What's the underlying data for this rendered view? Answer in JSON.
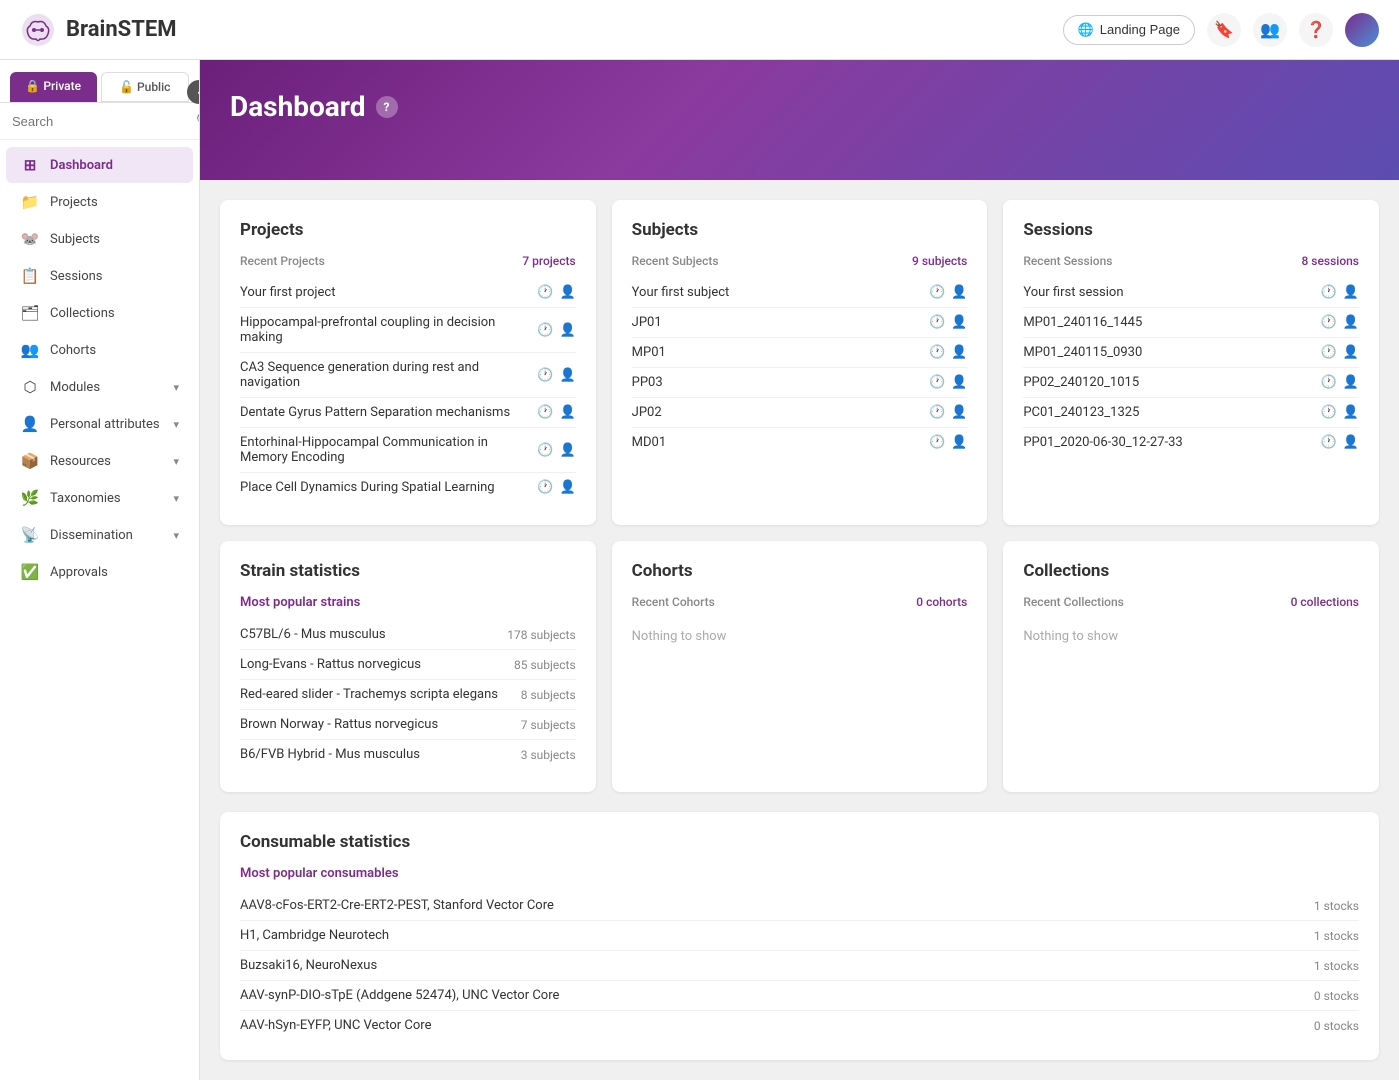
{
  "app": {
    "title": "BrainSTEM"
  },
  "navbar": {
    "landing_page_label": "Landing Page",
    "icons": [
      "bookmark",
      "users",
      "help",
      "avatar"
    ]
  },
  "sidebar": {
    "tab_private": "Private",
    "tab_public": "Public",
    "search_placeholder": "Search",
    "nav_items": [
      {
        "id": "dashboard",
        "label": "Dashboard",
        "icon": "⊞",
        "active": true
      },
      {
        "id": "projects",
        "label": "Projects",
        "icon": "📁",
        "active": false
      },
      {
        "id": "subjects",
        "label": "Subjects",
        "icon": "🐭",
        "active": false
      },
      {
        "id": "sessions",
        "label": "Sessions",
        "icon": "📋",
        "active": false
      },
      {
        "id": "collections",
        "label": "Collections",
        "icon": "🗂",
        "active": false
      },
      {
        "id": "cohorts",
        "label": "Cohorts",
        "icon": "👥",
        "active": false
      },
      {
        "id": "modules",
        "label": "Modules",
        "icon": "⬡",
        "active": false,
        "has_chevron": true
      },
      {
        "id": "personal_attributes",
        "label": "Personal attributes",
        "icon": "👤",
        "active": false,
        "has_chevron": true
      },
      {
        "id": "resources",
        "label": "Resources",
        "icon": "📦",
        "active": false,
        "has_chevron": true
      },
      {
        "id": "taxonomies",
        "label": "Taxonomies",
        "icon": "🌿",
        "active": false,
        "has_chevron": true
      },
      {
        "id": "dissemination",
        "label": "Dissemination",
        "icon": "📡",
        "active": false,
        "has_chevron": true
      },
      {
        "id": "approvals",
        "label": "Approvals",
        "icon": "✅",
        "active": false
      }
    ]
  },
  "dashboard": {
    "title": "Dashboard",
    "projects": {
      "title": "Projects",
      "section_label": "Recent Projects",
      "section_count": "7 projects",
      "items": [
        {
          "name": "Your first project"
        },
        {
          "name": "Hippocampal-prefrontal coupling in decision making"
        },
        {
          "name": "CA3 Sequence generation during rest and navigation"
        },
        {
          "name": "Dentate Gyrus Pattern Separation mechanisms"
        },
        {
          "name": "Entorhinal-Hippocampal Communication in Memory Encoding"
        },
        {
          "name": "Place Cell Dynamics During Spatial Learning"
        }
      ]
    },
    "subjects": {
      "title": "Subjects",
      "section_label": "Recent Subjects",
      "section_count": "9 subjects",
      "items": [
        {
          "name": "Your first subject"
        },
        {
          "name": "JP01"
        },
        {
          "name": "MP01"
        },
        {
          "name": "PP03"
        },
        {
          "name": "JP02"
        },
        {
          "name": "MD01"
        }
      ]
    },
    "sessions": {
      "title": "Sessions",
      "section_label": "Recent Sessions",
      "section_count": "8 sessions",
      "items": [
        {
          "name": "Your first session"
        },
        {
          "name": "MP01_240116_1445"
        },
        {
          "name": "MP01_240115_0930"
        },
        {
          "name": "PP02_240120_1015"
        },
        {
          "name": "PC01_240123_1325"
        },
        {
          "name": "PP01_2020-06-30_12-27-33"
        }
      ]
    },
    "cohorts": {
      "title": "Cohorts",
      "section_label": "Recent Cohorts",
      "section_count": "0 cohorts",
      "nothing": "Nothing to show"
    },
    "collections": {
      "title": "Collections",
      "section_label": "Recent Collections",
      "section_count": "0 collections",
      "nothing": "Nothing to show"
    },
    "strain_stats": {
      "title": "Strain statistics",
      "section_label": "Most popular strains",
      "items": [
        {
          "name": "C57BL/6 - Mus musculus",
          "count": "178 subjects"
        },
        {
          "name": "Long-Evans - Rattus norvegicus",
          "count": "85 subjects"
        },
        {
          "name": "Red-eared slider - Trachemys scripta elegans",
          "count": "8 subjects"
        },
        {
          "name": "Brown Norway - Rattus norvegicus",
          "count": "7 subjects"
        },
        {
          "name": "B6/FVB Hybrid - Mus musculus",
          "count": "3 subjects"
        }
      ]
    },
    "consumable_stats": {
      "title": "Consumable statistics",
      "section_label": "Most popular consumables",
      "items": [
        {
          "name": "AAV8-cFos-ERT2-Cre-ERT2-PEST, Stanford Vector Core",
          "count": "1 stocks"
        },
        {
          "name": "H1, Cambridge Neurotech",
          "count": "1 stocks"
        },
        {
          "name": "Buzsaki16, NeuroNexus",
          "count": "1 stocks"
        },
        {
          "name": "AAV-synP-DIO-sTpE (Addgene 52474), UNC Vector Core",
          "count": "0 stocks"
        },
        {
          "name": "AAV-hSyn-EYFP, UNC Vector Core",
          "count": "0 stocks"
        }
      ]
    }
  }
}
